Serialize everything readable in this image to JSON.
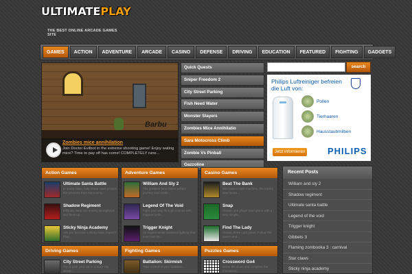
{
  "site": {
    "logo_main": "ULTIMATE",
    "logo_play": "PLAY",
    "tagline": "THE BEST ONLINE ARCADE GAMES SITE"
  },
  "nav": [
    "GAMES",
    "ACTION",
    "ADVENTURE",
    "ARCADE",
    "CASINO",
    "DEFENSE",
    "DRIVING",
    "EDUCATION",
    "FEATURED",
    "FIGHTING",
    "GADGETS"
  ],
  "featured": {
    "sign": "Barbu",
    "title": "Zombies mice annihilation",
    "desc": "Join Doctor Evilbot in the extreme shooting game! Enjoy wating mice? Time to pay off has come! COMPLETELY rune..."
  },
  "quick": [
    "Quick Quests",
    "Sniper Freedom 2",
    "City Street Parking",
    "Fish Need Water",
    "Monster Slayers",
    "Zombies Mice Annihilatio",
    "Sara Motocross Climb",
    "Zombie Vs Pinball",
    "Gazzoline"
  ],
  "search": {
    "button": "search",
    "placeholder": ""
  },
  "ad": {
    "headline": "Philips Luftreiniger befreien die Luft von:",
    "items": [
      "Pollen",
      "Tierhaaren",
      "Hausstaubmilben"
    ],
    "cta": "Jetzt informieren",
    "brand": "PHILIPS"
  },
  "categories": [
    {
      "title": "Action Games",
      "games": [
        {
          "name": "Ultimate Santa Battle",
          "desc": "In santa claus, help santa claus protect the presents from the enemy..."
        },
        {
          "name": "Shadow Regiment",
          "desc": "Infiltrate deep into enemy strongholds and blow up..."
        },
        {
          "name": "Sticky Ninja Academy",
          "desc": "Are you become a sticky ninja, expert? Play..."
        }
      ]
    },
    {
      "title": "Adventure Games",
      "games": [
        {
          "name": "William And Sly 2",
          "desc": "The greatest fans stolen william journey and castle..."
        },
        {
          "name": "Legend Of The Void",
          "desc": "Fight your way through curious with magical lords..."
        },
        {
          "name": "Trigger Knight",
          "desc": "An experimental medieval fighting that even can be..."
        }
      ]
    },
    {
      "title": "Casino Games",
      "games": [
        {
          "name": "Beat The Bank",
          "desc": "Win casino cash machine, the bank's new found..."
        },
        {
          "name": "Snap",
          "desc": "Classic one player card game with a very simple..."
        },
        {
          "name": "Find The Lady",
          "desc": "Classic three card game. Follow the queen and..."
        }
      ]
    },
    {
      "title": "Driving Games",
      "games": [
        {
          "name": "City Street Parking",
          "desc": "Try to park your car in a busy city street..."
        }
      ]
    },
    {
      "title": "Fighting Games",
      "games": [
        {
          "name": "Battalion: Skirmish",
          "desc": "Take control of your battalion..."
        }
      ]
    },
    {
      "title": "Puzzles Games",
      "games": [
        {
          "name": "Crossword Go4",
          "desc": "Solve the clues and complete the crossword..."
        }
      ]
    }
  ],
  "recent": {
    "title": "Recent Posts",
    "items": [
      "William and sly 2",
      "Shadow regiment",
      "Ultimate santa battle",
      "Legend of the void",
      "Trigger knight",
      "Gibbets 3",
      "Flaming zombooka 3 : carnival",
      "Star claws",
      "Sticky ninja academy"
    ]
  }
}
